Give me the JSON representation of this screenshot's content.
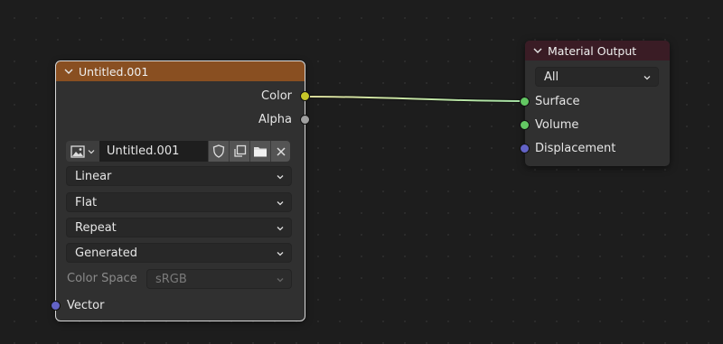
{
  "image_node": {
    "title": "Untitled.001",
    "header_color": "#894f21",
    "outputs": [
      {
        "label": "Color",
        "socket_color": "#c7c729"
      },
      {
        "label": "Alpha",
        "socket_color": "#a1a1a1"
      }
    ],
    "image_name": "Untitled.001",
    "interpolation": "Linear",
    "projection": "Flat",
    "extension": "Repeat",
    "source": "Generated",
    "color_space_label": "Color Space",
    "color_space_value": "sRGB",
    "input": {
      "label": "Vector",
      "socket_color": "#6363c7"
    }
  },
  "output_node": {
    "title": "Material Output",
    "header_color": "#3a1c25",
    "target": "All",
    "inputs": [
      {
        "label": "Surface",
        "socket_color": "#63c763"
      },
      {
        "label": "Volume",
        "socket_color": "#63c763"
      },
      {
        "label": "Displacement",
        "socket_color": "#6363c7"
      }
    ]
  },
  "link": {
    "from": "Color",
    "to": "Surface",
    "color_start": "#d4d45a",
    "color_end": "#7ed67e"
  }
}
